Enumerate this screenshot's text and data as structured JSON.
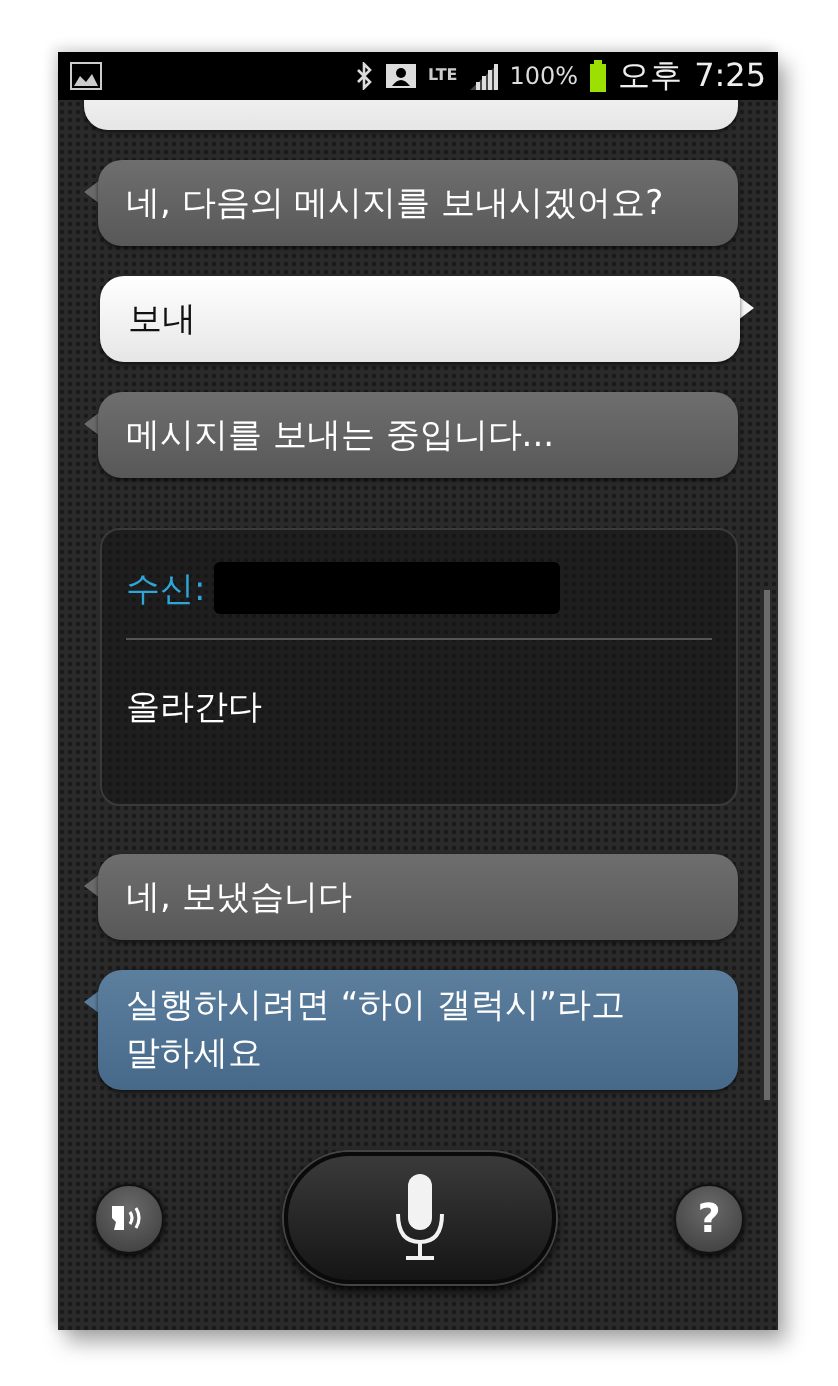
{
  "status_bar": {
    "network": "LTE",
    "battery": "100%",
    "am_pm": "오후",
    "time": "7:25"
  },
  "conversation": [
    {
      "kind": "user"
    },
    {
      "kind": "assistant",
      "text": "네, 다음의 메시지를 보내시겠어요?"
    },
    {
      "kind": "user",
      "text": "보내"
    },
    {
      "kind": "assistant",
      "text": "메시지를 보내는 중입니다..."
    },
    {
      "kind": "message",
      "recipient_label": "수신:",
      "body": "올라간다"
    },
    {
      "kind": "assistant",
      "text": "네, 보냈습니다"
    },
    {
      "kind": "hint",
      "text": "실행하시려면 “하이 갤럭시”라고 말하세요"
    }
  ],
  "controls": {
    "help_label": "?"
  }
}
